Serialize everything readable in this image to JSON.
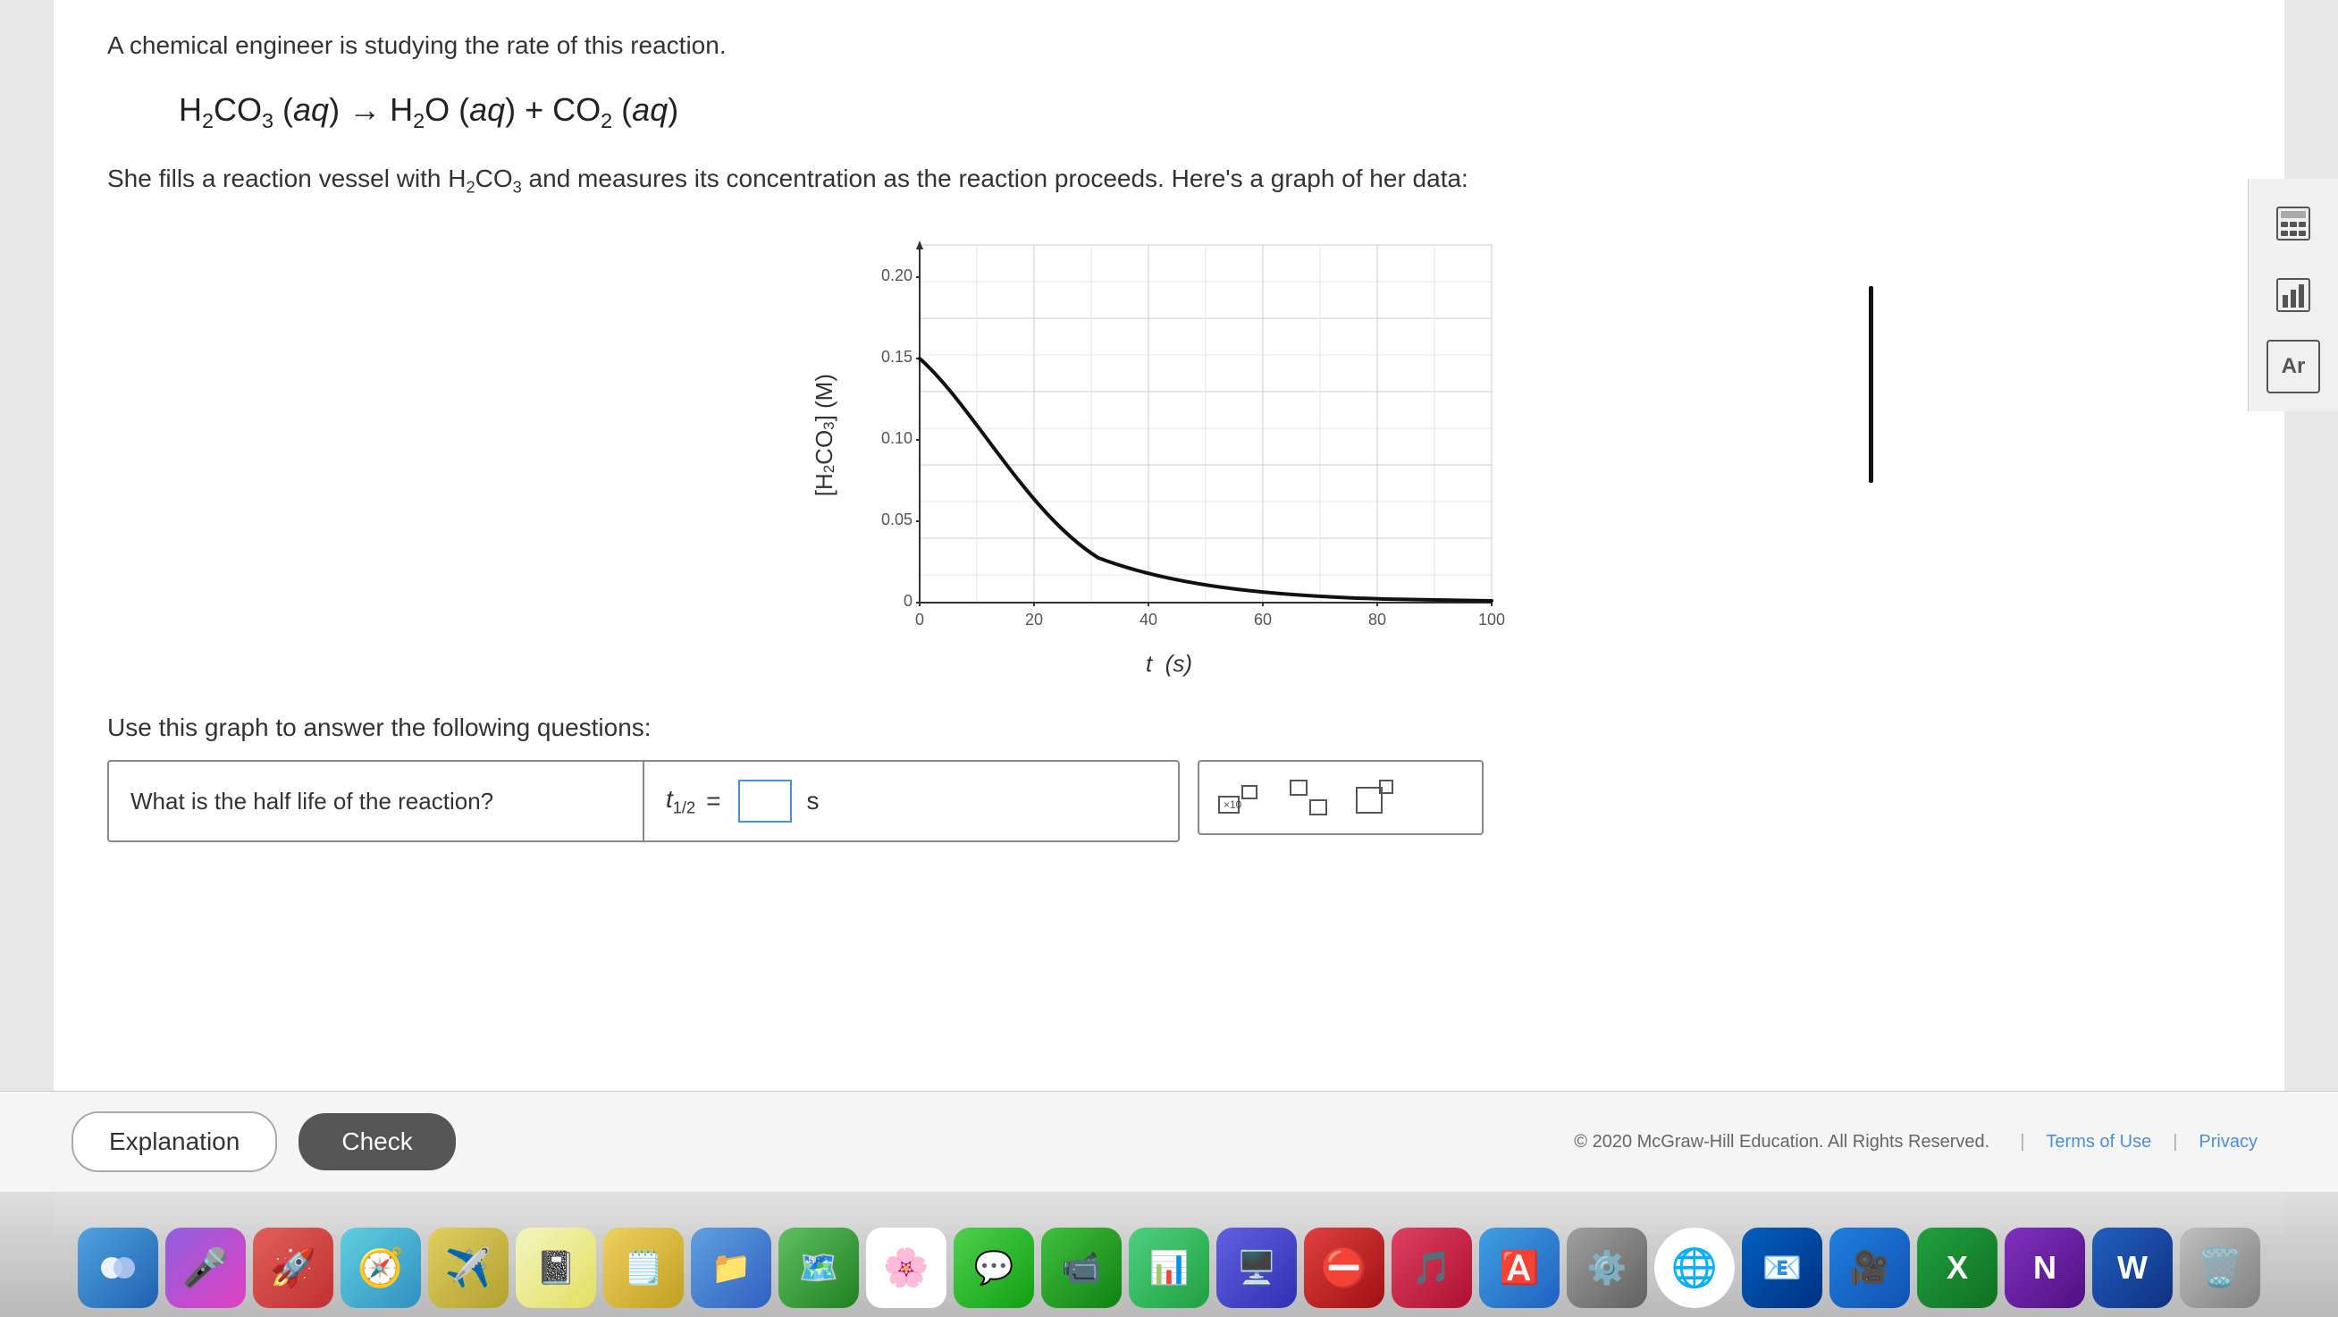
{
  "page": {
    "question_intro": "A chemical engineer is studying the rate of this reaction.",
    "equation_html": "H₂CO₃(aq) → H₂O(aq) + CO₂(aq)",
    "description": "She fills a reaction vessel with H₂CO₃ and measures its concentration as the reaction proceeds. Here's a graph of her data:",
    "use_graph_text": "Use this graph to answer the following questions:",
    "question": "What is the half life of the reaction?",
    "answer_prefix": "t",
    "answer_subscript": "1/2",
    "answer_equals": "=",
    "answer_unit": "s",
    "y_axis_label": "[H₂CO₃] (M)",
    "x_axis_label": "t  (s)",
    "graph": {
      "y_ticks": [
        "0",
        "0.05",
        "0.10",
        "0.15",
        "0.20"
      ],
      "x_ticks": [
        "0",
        "20",
        "40",
        "60",
        "80",
        "100"
      ],
      "curve_type": "exponential_decay",
      "start_value": 0.15,
      "end_value": 0.01
    },
    "buttons": {
      "explanation": "Explanation",
      "check": "Check"
    },
    "footer": {
      "copyright": "© 2020 McGraw-Hill Education. All Rights Reserved.",
      "terms": "Terms of Use",
      "privacy": "Privacy"
    },
    "math_toolbar": {
      "btn1": "×10",
      "btn2": "□",
      "btn3": "□"
    },
    "sidebar_icons": {
      "calculator": "🖩",
      "chart": "📊",
      "periodic": "Ar"
    },
    "dock_apps": [
      "🍎",
      "🎤",
      "🚀",
      "🧭",
      "✈️",
      "📓",
      "🗒️",
      "📁",
      "🗺️",
      "🌸",
      "💬",
      "🗺️",
      "📊",
      "🖥️",
      "⛔",
      "🎵",
      "🅰️",
      "🌐",
      "📧",
      "🎥",
      "✗",
      "📊",
      "📝",
      "🗑️"
    ]
  }
}
